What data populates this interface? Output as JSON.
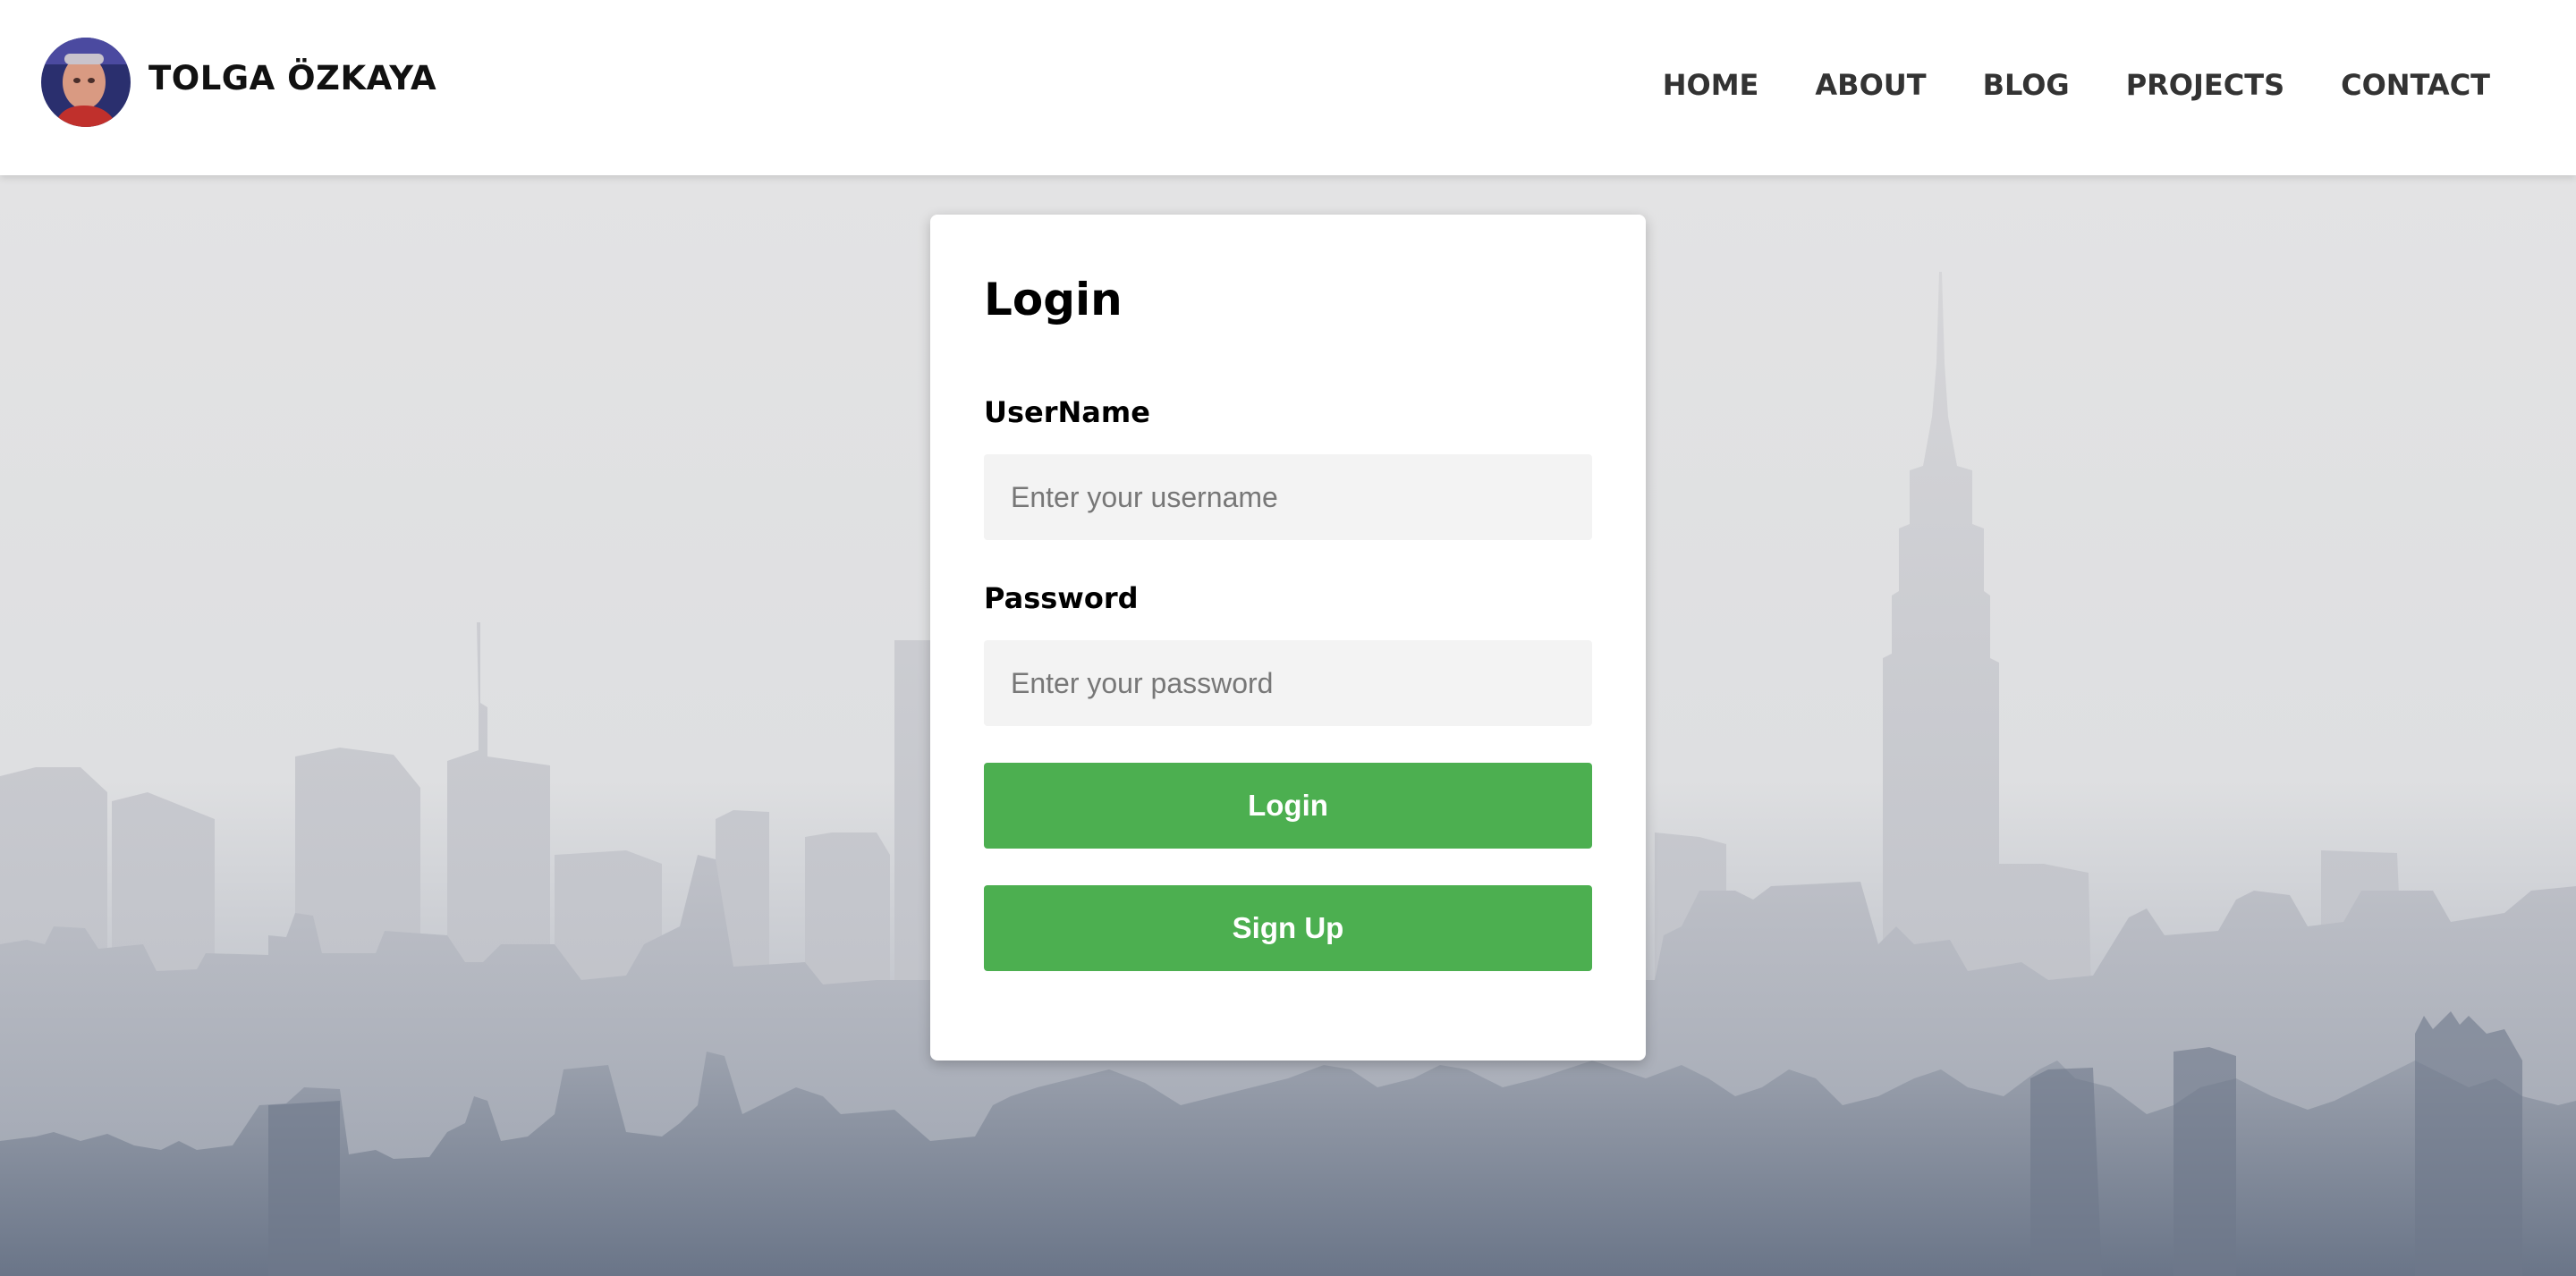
{
  "header": {
    "brand_name": "TOLGA ÖZKAYA",
    "avatar_icon": "profile-photo",
    "nav": [
      {
        "label": "HOME"
      },
      {
        "label": "ABOUT"
      },
      {
        "label": "BLOG"
      },
      {
        "label": "PROJECTS"
      },
      {
        "label": "CONTACT"
      }
    ]
  },
  "login_form": {
    "title": "Login",
    "username_label": "UserName",
    "username_placeholder": "Enter your username",
    "username_value": "",
    "password_label": "Password",
    "password_placeholder": "Enter your password",
    "password_value": "",
    "login_button": "Login",
    "signup_button": "Sign Up"
  },
  "colors": {
    "header_bg": "#ffffff",
    "button_green": "#4caf50",
    "input_bg": "#f3f3f3",
    "page_bg_top": "#e3e3e4",
    "page_bg_bottom": "#6f7a8c"
  },
  "background": {
    "icon": "city-skyline-illustration"
  }
}
